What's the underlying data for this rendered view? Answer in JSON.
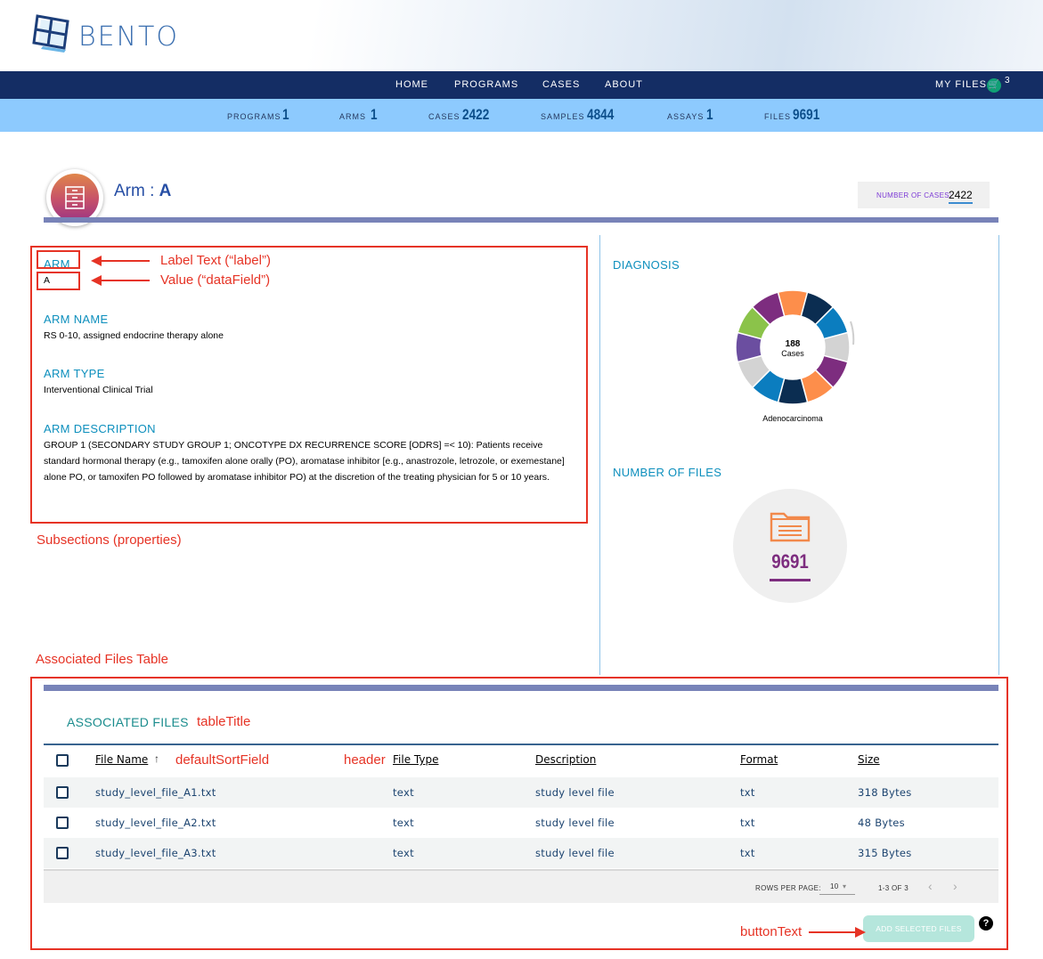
{
  "brand": {
    "name": "BENTO"
  },
  "nav": {
    "items": [
      {
        "label": "HOME"
      },
      {
        "label": "PROGRAMS"
      },
      {
        "label": "CASES"
      },
      {
        "label": "ABOUT"
      }
    ],
    "my_files": "MY FILES",
    "cart_count": "3"
  },
  "stats": [
    {
      "label": "PROGRAMS",
      "value": "1"
    },
    {
      "label": "ARMS",
      "value": "1"
    },
    {
      "label": "CASES",
      "value": "2422"
    },
    {
      "label": "SAMPLES",
      "value": "4844"
    },
    {
      "label": "ASSAYS",
      "value": "1"
    },
    {
      "label": "FILES",
      "value": "9691"
    }
  ],
  "header": {
    "prefix": "Arm :",
    "arm_id": "A",
    "number_of_cases_label": "NUMBER OF CASES:",
    "number_of_cases": "2422"
  },
  "properties": [
    {
      "label": "ARM",
      "value": "A"
    },
    {
      "label": "ARM NAME",
      "value": "RS 0-10, assigned endocrine therapy alone"
    },
    {
      "label": "ARM TYPE",
      "value": "Interventional Clinical Trial"
    },
    {
      "label": "ARM DESCRIPTION",
      "value": "GROUP 1 (SECONDARY STUDY GROUP 1; ONCOTYPE DX RECURRENCE SCORE [ODRS] =< 10): Patients receive standard hormonal therapy (e.g., tamoxifen alone orally (PO), aromatase inhibitor [e.g., anastrozole, letrozole, or exemestane] alone PO, or tamoxifen PO followed by aromatase inhibitor PO) at the discretion of the treating physician for 5 or 10 years."
    }
  ],
  "diagnosis": {
    "title": "DIAGNOSIS",
    "center_value": "188",
    "center_label": "Cases",
    "caption": "Adenocarcinoma",
    "segment_colors": [
      "#fd8e4b",
      "#0b2d51",
      "#0b7dbf",
      "#d3d3d3",
      "#7d2d7f",
      "#fd8e4b",
      "#0b2d51",
      "#0b7dbf",
      "#d3d3d3",
      "#6b4ea0",
      "#8bc34a",
      "#7d2d7f"
    ]
  },
  "files_widget": {
    "title": "NUMBER OF FILES",
    "value": "9691",
    "icon": "folder-icon"
  },
  "annotations": {
    "label_text": "Label Text (“label”)",
    "value_text": "Value (“dataField”)",
    "subsections": "Subsections (properties)",
    "assoc_table": "Associated Files Table",
    "table_title": "tableTitle",
    "default_sort": "defaultSortField",
    "header": "header",
    "button_text": "buttonText"
  },
  "table": {
    "title": "ASSOCIATED FILES",
    "columns": [
      "File Name",
      "File Type",
      "Description",
      "Format",
      "Size"
    ],
    "sort_icon": "arrow-up-icon",
    "rows": [
      [
        "study_level_file_A1.txt",
        "text",
        "study level file",
        "txt",
        "318 Bytes"
      ],
      [
        "study_level_file_A2.txt",
        "text",
        "study level file",
        "txt",
        "48 Bytes"
      ],
      [
        "study_level_file_A3.txt",
        "text",
        "study level file",
        "txt",
        "315 Bytes"
      ]
    ],
    "rows_per_page_label": "ROWS PER PAGE:",
    "rows_per_page": "10",
    "range": "1-3 OF 3",
    "button": "ADD SELECTED FILES",
    "help": "?"
  },
  "colors": {
    "nav_bg": "#142d64",
    "stats_bg": "#8dcafe",
    "accent": "#0d8fbd",
    "annotation": "#e63325"
  }
}
